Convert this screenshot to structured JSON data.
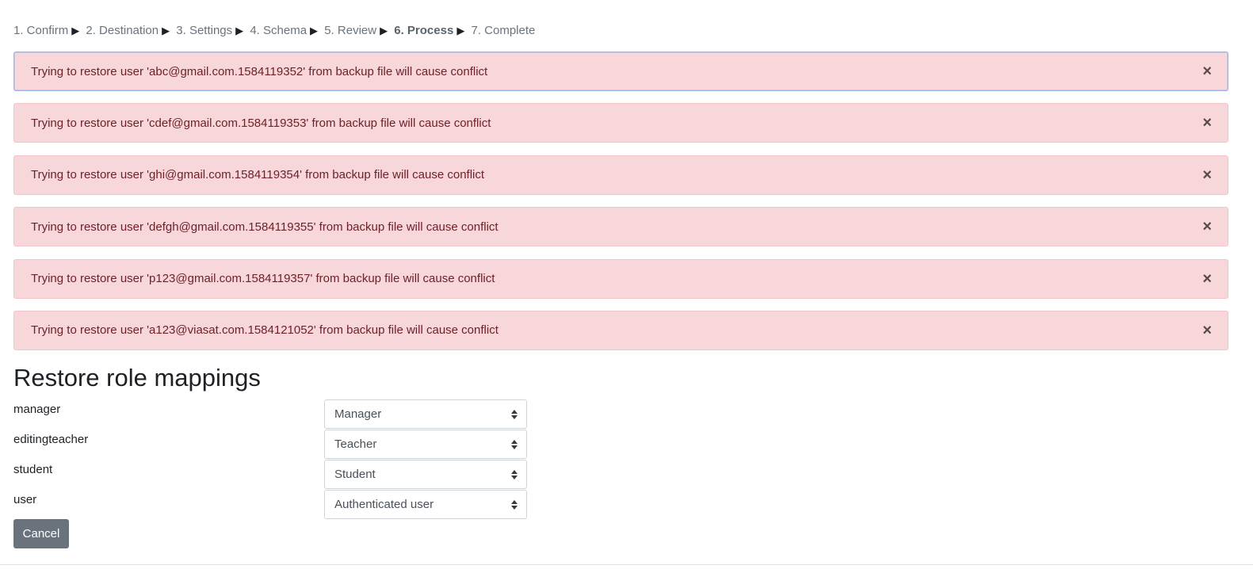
{
  "steps": [
    {
      "label": "1. Confirm",
      "current": false
    },
    {
      "label": "2. Destination",
      "current": false
    },
    {
      "label": "3. Settings",
      "current": false
    },
    {
      "label": "4. Schema",
      "current": false
    },
    {
      "label": "5. Review",
      "current": false
    },
    {
      "label": "6. Process",
      "current": true
    },
    {
      "label": "7. Complete",
      "current": false
    }
  ],
  "step_separator": "▶",
  "alerts": [
    {
      "message": "Trying to restore user 'abc@gmail.com.1584119352' from backup file will cause conflict",
      "close": "×"
    },
    {
      "message": "Trying to restore user 'cdef@gmail.com.1584119353' from backup file will cause conflict",
      "close": "×"
    },
    {
      "message": "Trying to restore user 'ghi@gmail.com.1584119354' from backup file will cause conflict",
      "close": "×"
    },
    {
      "message": "Trying to restore user 'defgh@gmail.com.1584119355' from backup file will cause conflict",
      "close": "×"
    },
    {
      "message": "Trying to restore user 'p123@gmail.com.1584119357' from backup file will cause conflict",
      "close": "×"
    },
    {
      "message": "Trying to restore user 'a123@viasat.com.1584121052' from backup file will cause conflict",
      "close": "×"
    }
  ],
  "role_mappings": {
    "title": "Restore role mappings",
    "rows": [
      {
        "role": "manager",
        "selected": "Manager"
      },
      {
        "role": "editingteacher",
        "selected": "Teacher"
      },
      {
        "role": "student",
        "selected": "Student"
      },
      {
        "role": "user",
        "selected": "Authenticated user"
      }
    ]
  },
  "buttons": {
    "cancel": "Cancel"
  },
  "colors": {
    "alert_bg": "#f7d7da",
    "alert_text": "#6e2128",
    "cancel_bg": "#6a737b",
    "focus_border": "#9bb3f0"
  }
}
